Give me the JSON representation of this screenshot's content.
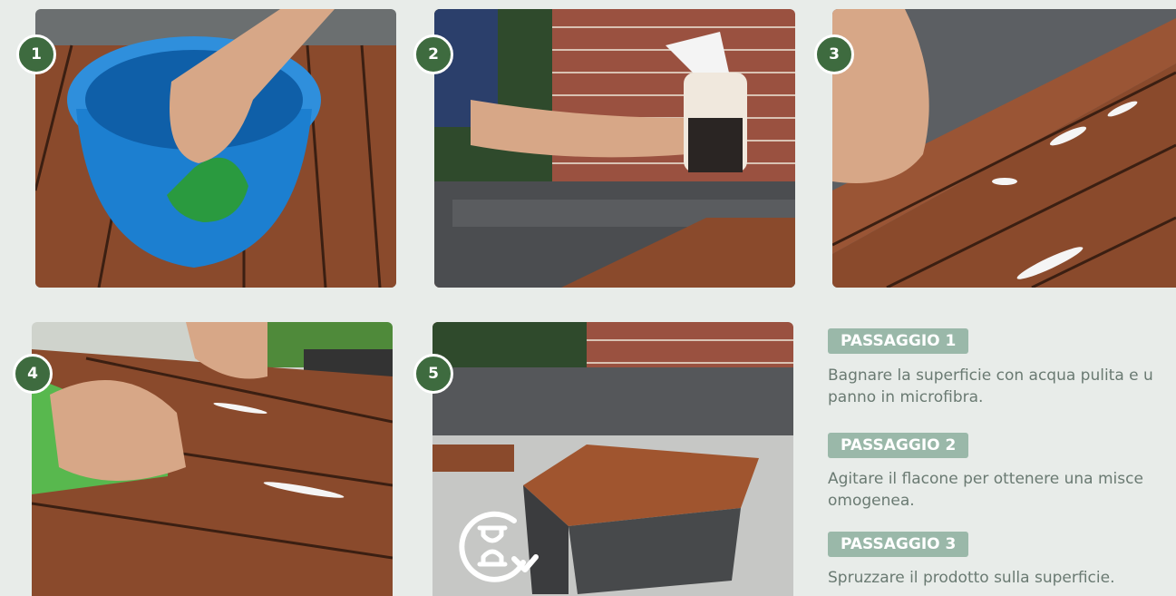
{
  "steps_photos": [
    {
      "number": "1"
    },
    {
      "number": "2"
    },
    {
      "number": "3"
    },
    {
      "number": "4"
    },
    {
      "number": "5"
    }
  ],
  "instructions": [
    {
      "title": "PASSAGGIO 1",
      "text": "Bagnare la superficie con acqua pulita e u panno in microfibra."
    },
    {
      "title": "PASSAGGIO 2",
      "text": "Agitare il flacone per ottenere una misce omogenea."
    },
    {
      "title": "PASSAGGIO  3",
      "text": "Spruzzare il prodotto sulla superficie."
    }
  ],
  "colors": {
    "badge": "#3e6b3f",
    "title_bg": "#9ab8a9",
    "text": "#6a7a72",
    "background": "#e8ece9"
  },
  "icons": {
    "wait": "hourglass-rotate-icon"
  }
}
